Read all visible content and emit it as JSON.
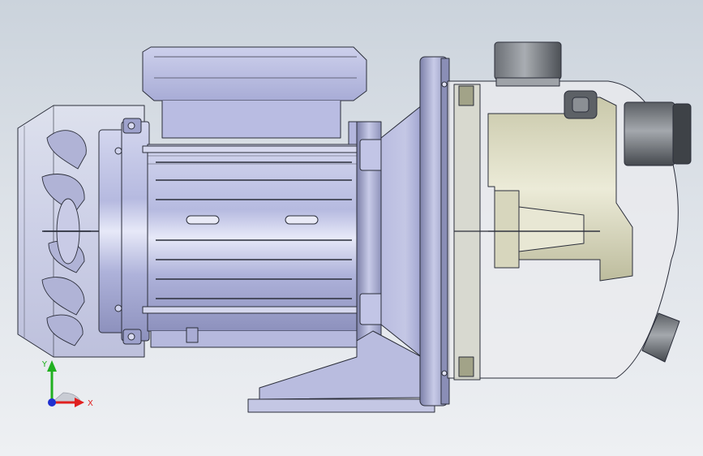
{
  "viewport": {
    "background_top": "#cbd3dc",
    "background_bottom": "#eef0f3"
  },
  "model": {
    "motor_color": "#b9bde2",
    "pump_color": "#e0e0dc",
    "shaft_color": "#c8cad0",
    "port_color": "#5a5e63",
    "edge_color": "#2b2e3a"
  },
  "triad": {
    "x_label": "X",
    "y_label": "Y",
    "x_color": "#e02020",
    "y_color": "#20b020",
    "z_color": "#2030d0"
  }
}
